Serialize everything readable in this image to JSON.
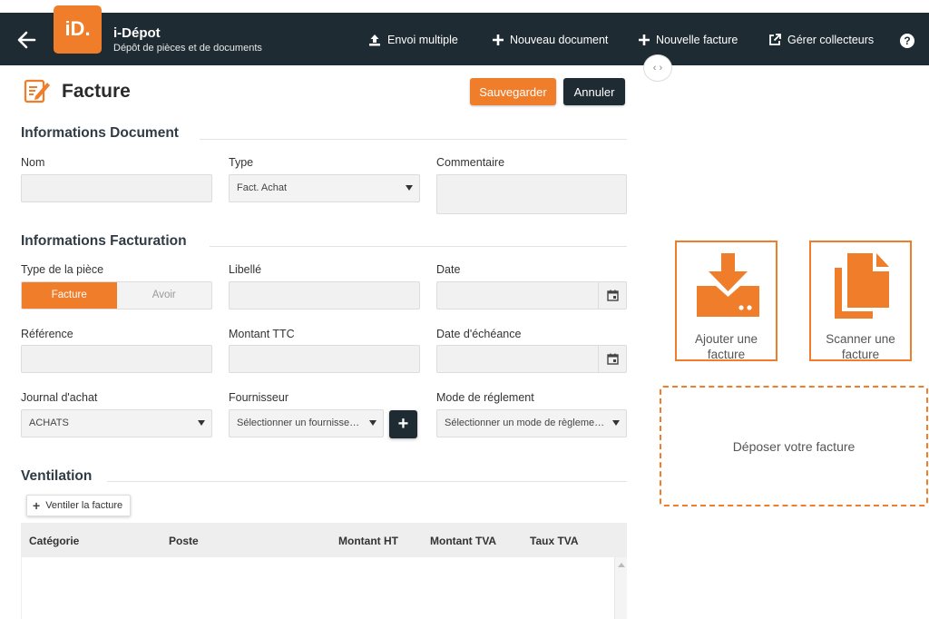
{
  "app": {
    "title": "i-Dépot",
    "subtitle": "Dépôt de pièces et de documents",
    "logo_text": "iD."
  },
  "nav": {
    "envoi_multiple": "Envoi multiple",
    "nouveau_document": "Nouveau document",
    "nouvelle_facture": "Nouvelle facture",
    "gerer_collecteurs": "Gérer collecteurs",
    "help": "?"
  },
  "page": {
    "title": "Facture",
    "save_label": "Sauvegarder",
    "cancel_label": "Annuler"
  },
  "doc_section": {
    "title": "Informations Document",
    "nom_label": "Nom",
    "nom_value": "",
    "type_label": "Type",
    "type_value": "Fact. Achat",
    "commentaire_label": "Commentaire",
    "commentaire_value": ""
  },
  "fact_section": {
    "title": "Informations Facturation",
    "type_piece_label": "Type de la pièce",
    "type_piece_options": [
      "Facture",
      "Avoir"
    ],
    "type_piece_selected": "Facture",
    "libelle_label": "Libellé",
    "date_label": "Date",
    "reference_label": "Référence",
    "montant_ttc_label": "Montant TTC",
    "date_echeance_label": "Date d'échéance",
    "journal_label": "Journal d'achat",
    "journal_value": "ACHATS",
    "fournisseur_label": "Fournisseur",
    "fournisseur_placeholder": "Sélectionner un fournisseur...",
    "mode_reglement_label": "Mode de réglement",
    "mode_reglement_placeholder": "Sélectionner un mode de règlement..."
  },
  "ventilation": {
    "title": "Ventilation",
    "ventiler_label": "Ventiler la facture",
    "columns": [
      "Catégorie",
      "Poste",
      "Montant HT",
      "Montant TVA",
      "Taux TVA"
    ],
    "rows": []
  },
  "right_panel": {
    "ajouter_label": "Ajouter une facture",
    "scanner_label": "Scanner une facture",
    "drop_label": "Déposer votre facture"
  },
  "colors": {
    "accent": "#f07d2a",
    "navbar": "#1f2b33"
  },
  "icons": {
    "back": "arrow-left-icon",
    "upload": "upload-icon",
    "plus": "plus-icon",
    "external": "external-link-icon",
    "help": "question-circle-icon",
    "edit": "edit-document-icon",
    "calendar": "calendar-icon",
    "download_tray": "download-tray-icon",
    "documents": "documents-icon"
  }
}
